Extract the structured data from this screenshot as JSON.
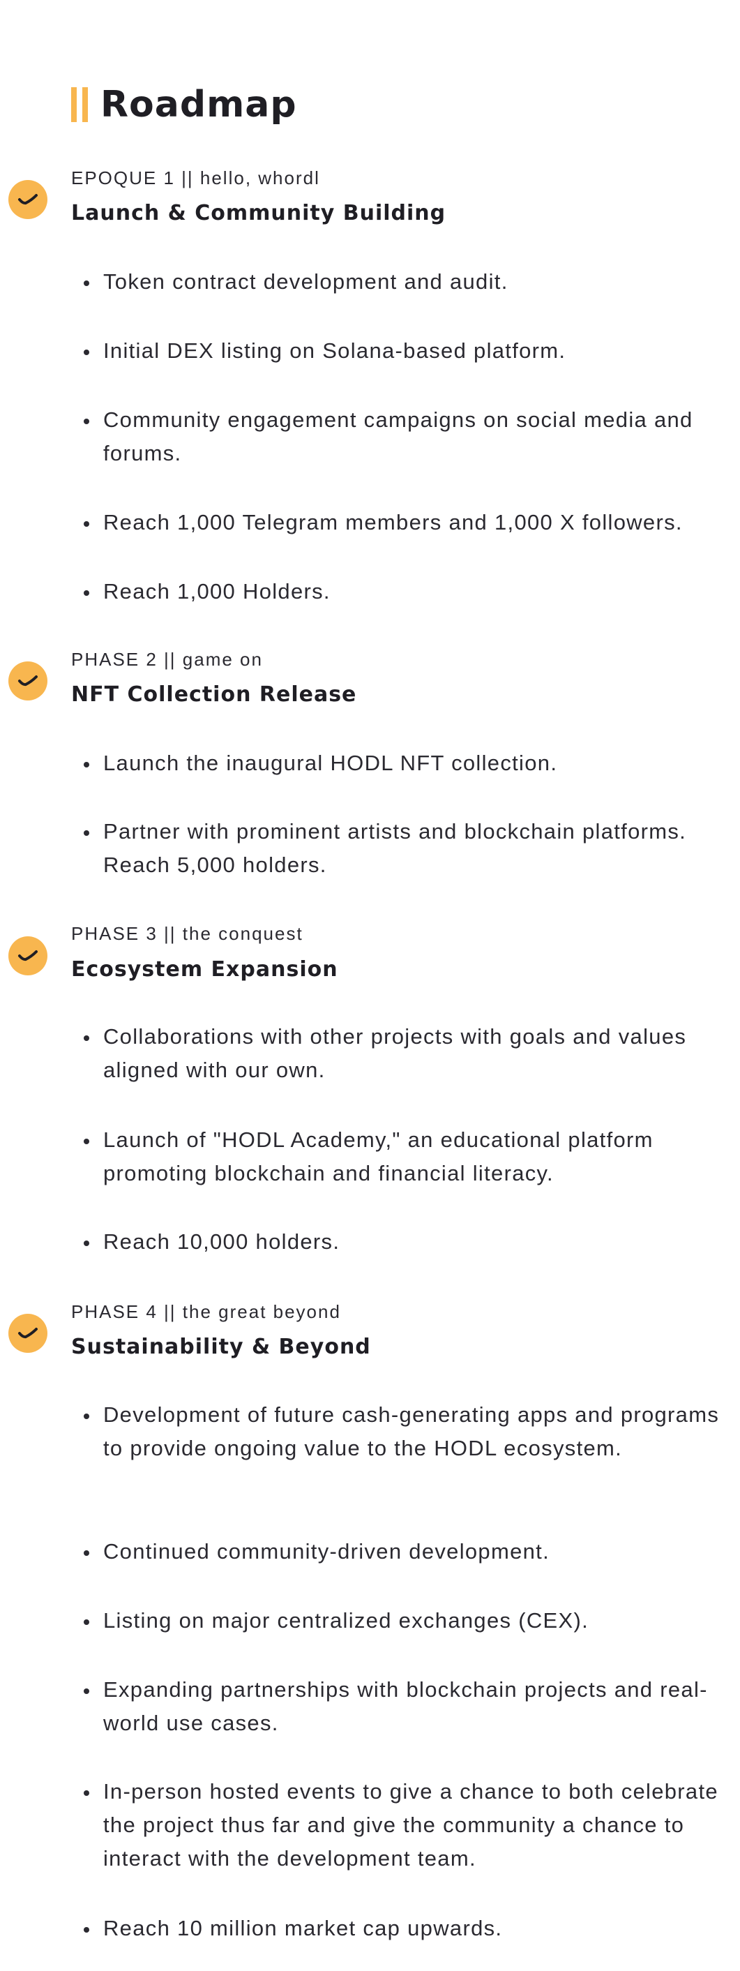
{
  "colors": {
    "accent": "#f8b64f",
    "text": "#1f1e24"
  },
  "header": {
    "title": "Roadmap"
  },
  "phases": [
    {
      "label": "EPOQUE 1 || hello, whordl",
      "title": "Launch & Community Building",
      "icon": "check-icon",
      "items": [
        "Token contract development and audit.",
        "Initial DEX listing on Solana-based platform.",
        "Community engagement campaigns on social media and forums.",
        "Reach 1,000 Telegram members and 1,000 X followers.",
        "Reach 1,000 Holders."
      ]
    },
    {
      "label": "PHASE 2 || game on",
      "title": "NFT Collection Release",
      "icon": "check-icon",
      "items": [
        "Launch the inaugural HODL NFT collection.",
        "Partner with prominent artists and blockchain platforms. Reach 5,000 holders."
      ]
    },
    {
      "label": "PHASE 3 || the conquest",
      "title": "Ecosystem Expansion",
      "icon": "check-icon",
      "items": [
        "Collaborations with other projects with goals and values aligned with our own.",
        "Launch of \"HODL Academy,\" an educational platform promoting blockchain and financial literacy.",
        "Reach 10,000 holders."
      ]
    },
    {
      "label": "PHASE 4 || the great beyond",
      "title": "Sustainability & Beyond",
      "icon": "check-icon",
      "items": [
        " Development of future cash-generating apps and programs to provide ongoing value to the HODL ecosystem.",
        "Continued community-driven development.",
        "Listing on major centralized exchanges (CEX).",
        "Expanding partnerships with blockchain projects and real-world use cases.",
        "In-person hosted events to give a chance to both celebrate the project thus far and give the community a chance to interact with the development team.",
        "Reach 10 million market cap upwards."
      ]
    }
  ]
}
